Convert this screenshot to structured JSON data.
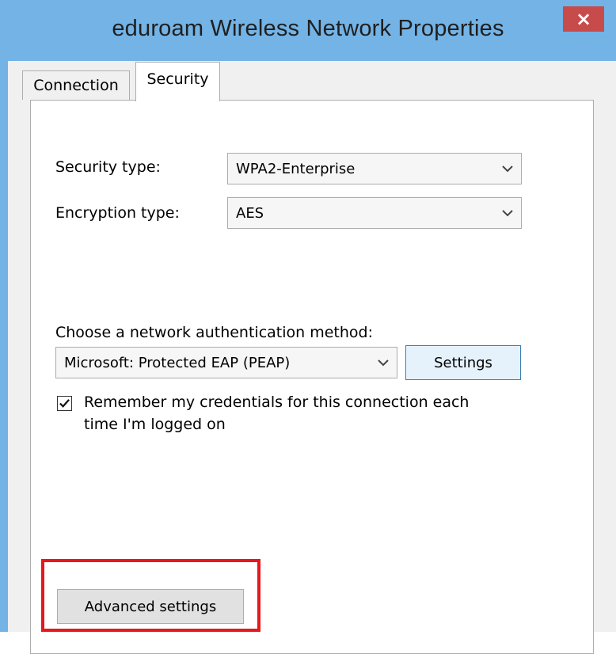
{
  "window": {
    "title": "eduroam Wireless Network Properties",
    "close_glyph": "×",
    "title_bar_color": "#73b3e6",
    "close_color": "#c84b4b"
  },
  "tabs": [
    {
      "label": "Connection",
      "selected": false
    },
    {
      "label": "Security",
      "selected": true
    }
  ],
  "security": {
    "security_type_label": "Security type:",
    "security_type_value": "WPA2-Enterprise",
    "encryption_type_label": "Encryption type:",
    "encryption_type_value": "AES",
    "auth_method_label": "Choose a network authentication method:",
    "auth_method_value": "Microsoft: Protected EAP (PEAP)",
    "settings_button": "Settings",
    "remember_checked": true,
    "remember_line1": "Remember my credentials for this connection each",
    "remember_line2": "time I'm logged on",
    "advanced_button": "Advanced settings"
  },
  "annotation": {
    "highlight_color": "#e8171b"
  }
}
